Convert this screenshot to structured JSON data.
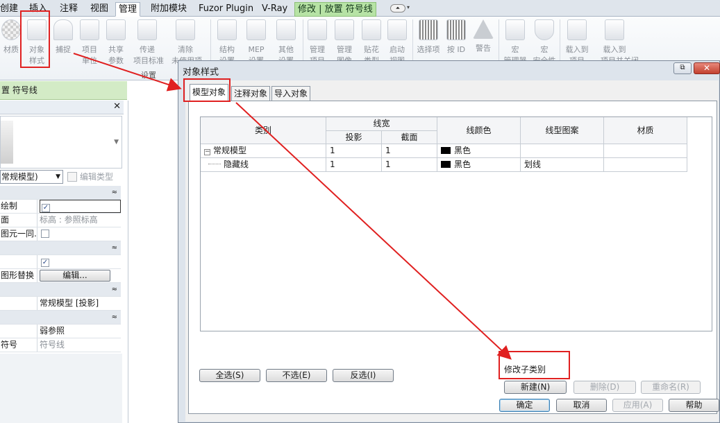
{
  "ribbon_tabs": [
    "创建",
    "插入",
    "注释",
    "视图",
    "管理",
    "附加模块",
    "Fuzor Plugin",
    "V-Ray",
    "修改 | 放置 符号线"
  ],
  "ribbon_tools": [
    {
      "label": "材质",
      "icon": "material-icon"
    },
    {
      "label": "对象\n样式",
      "icon": "object-styles-icon"
    },
    {
      "label": "捕捉",
      "icon": "snap-icon"
    },
    {
      "label": "项目\n单位",
      "icon": "project-units-icon"
    },
    {
      "label": "共享\n参数",
      "icon": "shared-params-icon"
    },
    {
      "label": "传递\n项目标准",
      "icon": "transfer-standards-icon"
    },
    {
      "label": "清除\n未使用项",
      "icon": "purge-icon"
    },
    {
      "label": "结构\n设置",
      "icon": "structural-settings-icon"
    },
    {
      "label": "MEP\n设置",
      "icon": "mep-settings-icon"
    },
    {
      "label": "其他\n设置",
      "icon": "other-settings-icon"
    },
    {
      "label": "管理\n项目",
      "icon": "manage-project-icon"
    },
    {
      "label": "管理\n图像",
      "icon": "manage-images-icon"
    },
    {
      "label": "贴花\n类型",
      "icon": "decal-icon"
    },
    {
      "label": "启动\n视图",
      "icon": "starting-view-icon"
    },
    {
      "label": "选择项",
      "icon": "selection-icon"
    },
    {
      "label": "按 ID",
      "icon": "select-by-id-icon"
    },
    {
      "label": "警告",
      "icon": "warning-icon"
    },
    {
      "label": "宏\n管理器",
      "icon": "macro-manager-icon"
    },
    {
      "label": "宏\n安全性",
      "icon": "macro-security-icon"
    },
    {
      "label": "载入到\n项目",
      "icon": "load-into-project-icon"
    },
    {
      "label": "载入到\n项目并关闭",
      "icon": "load-close-icon"
    }
  ],
  "ribbon_panel_settings": "设置",
  "context_strip": "置 符号线",
  "properties": {
    "type_selector": "常规模型)",
    "edit_type": "编辑类型",
    "rows": [
      {
        "kind": "section"
      },
      {
        "name": "绘制",
        "value": "checkbox-checked"
      },
      {
        "name": "面",
        "value": "标高 : 参照标高",
        "dim": true
      },
      {
        "name": "图元一同...",
        "value": "checkbox-empty"
      },
      {
        "kind": "section"
      },
      {
        "name": "",
        "value": "checkbox-checked"
      },
      {
        "name": "图形替换",
        "value": "编辑..."
      },
      {
        "kind": "section"
      },
      {
        "name": "",
        "value": "常规模型 [投影]"
      },
      {
        "kind": "section"
      },
      {
        "name": "",
        "value": "弱参照"
      },
      {
        "name": "符号",
        "value": "符号线",
        "dim": true
      }
    ]
  },
  "dialog": {
    "title": "对象样式",
    "tabs": [
      "模型对象",
      "注释对象",
      "导入对象"
    ],
    "table": {
      "headers": {
        "category": "类别",
        "line_weight": "线宽",
        "projection": "投影",
        "cut": "截面",
        "line_color": "线颜色",
        "line_pattern": "线型图案",
        "material": "材质"
      },
      "rows": [
        {
          "category": "常规模型",
          "projection": "1",
          "cut": "1",
          "color": "黑色",
          "pattern": "",
          "material": ""
        },
        {
          "category": "隐藏线",
          "projection": "1",
          "cut": "1",
          "color": "黑色",
          "pattern": "划线",
          "material": ""
        }
      ]
    },
    "buttons": {
      "select_all": "全选(S)",
      "select_none": "不选(E)",
      "invert": "反选(I)",
      "modify_subcategories": "修改子类别",
      "new": "新建(N)",
      "delete": "删除(D)",
      "rename": "重命名(R)",
      "ok": "确定",
      "cancel": "取消",
      "apply": "应用(A)",
      "help": "帮助"
    }
  },
  "colors": {
    "annotation": "#e02020",
    "context_tab": "#b7e3a5",
    "swatch": "#000000"
  }
}
